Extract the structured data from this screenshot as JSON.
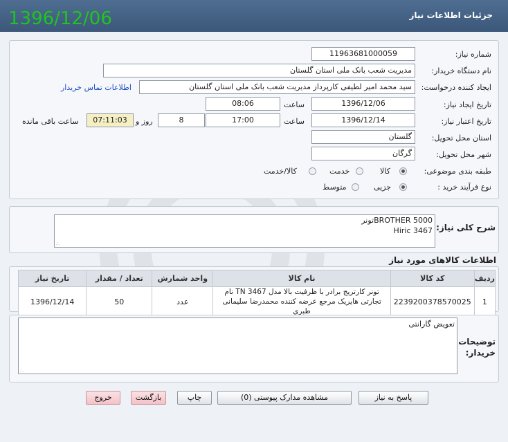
{
  "header": {
    "title": "جزئیات اطلاعات نیاز",
    "date_overlay": "1396/12/06"
  },
  "form": {
    "need_number_label": "شماره نیاز:",
    "need_number_value": "11963681000059",
    "buyer_org_label": "نام دستگاه خریدار:",
    "buyer_org_value": "مدیریت شعب بانک ملی استان گلستان",
    "requester_label": "ایجاد کننده درخواست:",
    "requester_value": "سید محمد امیر لطیفی کارپرداز مدیریت شعب بانک ملی استان گلستان",
    "contact_link": "اطلاعات تماس خریدار",
    "creation_date_label": "تاریخ ایجاد نیاز:",
    "creation_date_value": "1396/12/06",
    "time_label": "ساعت",
    "creation_time_value": "08:06",
    "validity_date_label": "تاریخ اعتبار نیاز:",
    "validity_date_value": "1396/12/14",
    "validity_time_value": "17:00",
    "days_value": "8",
    "day_and_label": "روز و",
    "remaining_time_value": "07:11:03",
    "remaining_label": "ساعت باقی مانده",
    "province_label": "استان محل تحویل:",
    "province_value": "گلستان",
    "city_label": "شهر محل تحویل:",
    "city_value": "گرگان",
    "category_label": "طبقه بندی موضوعی:",
    "category_options": [
      "کالا",
      "خدمت",
      "کالا/خدمت"
    ],
    "process_label": "نوع فرآیند خرید :",
    "process_options": [
      "جزیی",
      "متوسط"
    ]
  },
  "description": {
    "label": "شرح کلی نیاز:",
    "line1": "تونرBROTHER 5000",
    "line2": "Hiric 3467"
  },
  "items": {
    "title": "اطلاعات کالاهای مورد نیاز",
    "headers": [
      "ردیف",
      "کد کالا",
      "نام کالا",
      "واحد شمارش",
      "تعداد / مقدار",
      "تاریخ نیاز"
    ],
    "rows": [
      {
        "row": "1",
        "code": "2239200378570025",
        "name": "تونر کارتریج برادر با ظرفیت بالا مدل TN 3467 نام تجارتی هایریک مرجع عرضه کننده محمدرضا سلیمانی طبری",
        "unit": "عدد",
        "qty": "50",
        "date": "1396/12/14"
      }
    ]
  },
  "buyer_notes": {
    "label": "توضیحات خریدار:",
    "value": "تعویض گارانتی"
  },
  "buttons": {
    "reply": "پاسخ به نیاز",
    "attachments": "مشاهده مدارک پیوستی (0)",
    "print": "چاپ",
    "back": "بازگشت",
    "exit": "خروج"
  }
}
